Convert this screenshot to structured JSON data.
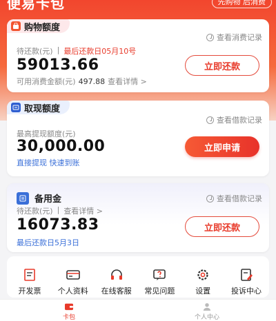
{
  "header": {
    "title": "便易卡包",
    "pill_text": "先购物 后消费"
  },
  "shopping": {
    "title": "购物额度",
    "record_link": "查看消费记录",
    "pending_label": "待还款(元)",
    "due_text": "最后还款日05月10号",
    "amount": "59013.66",
    "available_label": "可用消费金额(元)",
    "available_value": "497.88",
    "detail_link": "查看详情",
    "button": "立即还款"
  },
  "cash": {
    "title": "取现额度",
    "record_link": "查看借款记录",
    "max_label": "最高提现额度(元)",
    "amount": "30,000.00",
    "tagline": "直接提现 快速到账",
    "button": "立即申请"
  },
  "reserve": {
    "title": "备用金",
    "record_link": "查看借款记录",
    "pending_label": "待还款(元)",
    "detail_link": "查看详情",
    "amount": "16073.83",
    "due_text": "最后还款日5月3日",
    "button": "立即还款"
  },
  "shortcuts": [
    {
      "label": "开发票",
      "icon": "invoice-icon"
    },
    {
      "label": "个人资料",
      "icon": "id-card-icon"
    },
    {
      "label": "在线客服",
      "icon": "headset-icon"
    },
    {
      "label": "常见问题",
      "icon": "question-icon"
    },
    {
      "label": "设置",
      "icon": "gear-icon"
    },
    {
      "label": "投诉中心",
      "icon": "complaint-icon"
    }
  ],
  "tabs": [
    {
      "label": "卡包",
      "icon": "wallet-icon",
      "active": true
    },
    {
      "label": "个人中心",
      "icon": "user-icon",
      "active": false
    }
  ],
  "colors": {
    "accent": "#e83a2a",
    "link_blue": "#3a6fd8",
    "header_gradient_top": "#f2462e"
  }
}
